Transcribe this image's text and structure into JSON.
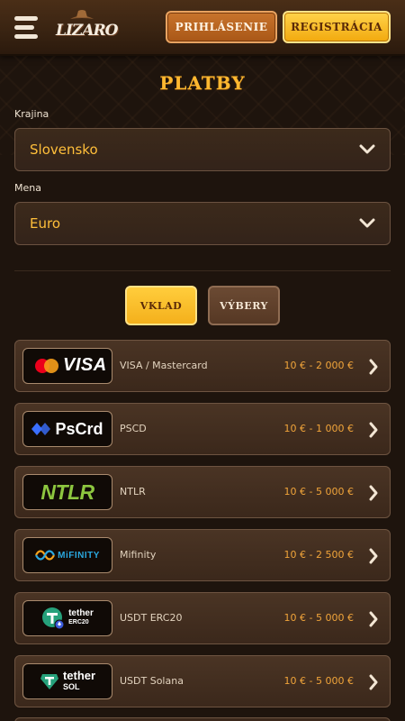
{
  "header": {
    "logo_text": "LIZARO",
    "login_label": "PRIHLÁSENIE",
    "register_label": "REGISTRÁCIA"
  },
  "page": {
    "title": "PLATBY"
  },
  "country": {
    "label": "Krajina",
    "value": "Slovensko"
  },
  "currency": {
    "label": "Mena",
    "value": "Euro"
  },
  "tabs": {
    "deposit": "VKLAD",
    "withdraw": "VÝBERY"
  },
  "methods": [
    {
      "logo": "VISA",
      "name": "VISA / Mastercard",
      "range": "10 € - 2 000 €"
    },
    {
      "logo": "PsCrd",
      "name": "PSCD",
      "range": "10 € - 1 000 €"
    },
    {
      "logo": "NTLR",
      "name": "NTLR",
      "range": "10 € - 5 000 €"
    },
    {
      "logo": "MiFINITY",
      "name": "Mifinity",
      "range": "10 € - 2 500 €"
    },
    {
      "logo_line1": "tether",
      "logo_line2": "ERC20",
      "name": "USDT ERC20",
      "range": "10 € - 5 000 €"
    },
    {
      "logo_line1": "tether",
      "logo_line2": "SOL",
      "name": "USDT Solana",
      "range": "10 € - 5 000 €"
    }
  ],
  "colors": {
    "accent": "#ffb830",
    "range": "#f0a43a",
    "tether": "#26a17b"
  }
}
